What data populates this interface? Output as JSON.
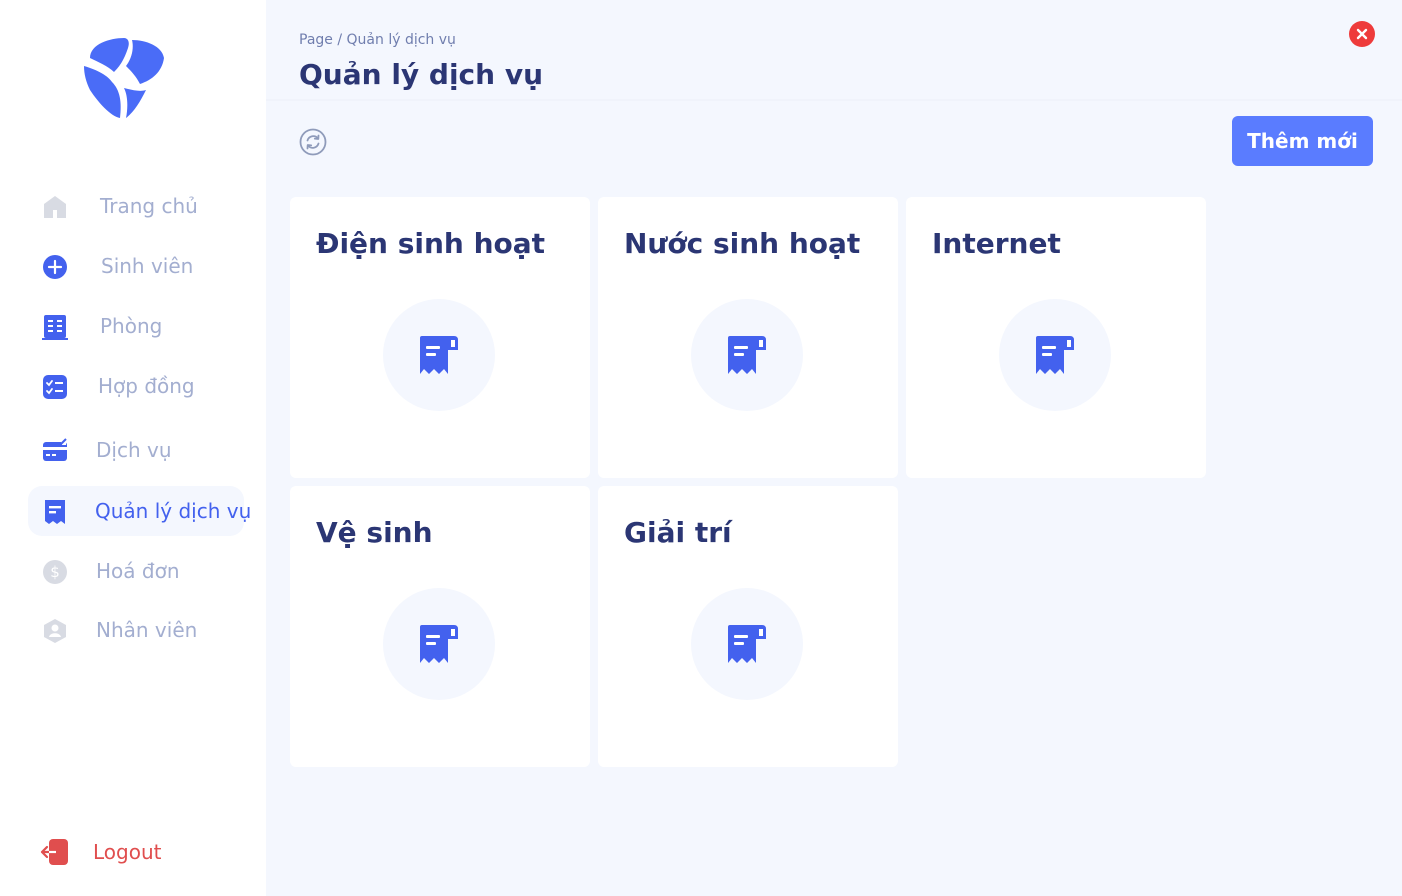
{
  "sidebar": {
    "items": [
      {
        "label": "Trang chủ",
        "icon": "home-icon"
      },
      {
        "label": "Sinh viên",
        "icon": "plus-circle-icon"
      },
      {
        "label": "Phòng",
        "icon": "building-icon"
      },
      {
        "label": "Hợp đồng",
        "icon": "checklist-icon"
      },
      {
        "label": "Dịch vụ",
        "icon": "card-edit-icon"
      },
      {
        "label": "Quản lý dịch vụ",
        "icon": "receipt-icon",
        "active": true
      },
      {
        "label": "Hoá đơn",
        "icon": "dollar-icon"
      },
      {
        "label": "Nhân viên",
        "icon": "user-icon"
      }
    ],
    "logout_label": "Logout"
  },
  "header": {
    "breadcrumb_root": "Page",
    "breadcrumb_sep": "/",
    "breadcrumb_current": "Quản lý dịch vụ",
    "title": "Quản lý dịch vụ"
  },
  "toolbar": {
    "add_label": "Thêm mới"
  },
  "services": [
    {
      "name": "Điện sinh hoạt"
    },
    {
      "name": "Nước sinh hoạt"
    },
    {
      "name": "Internet"
    },
    {
      "name": "Vệ sinh"
    },
    {
      "name": "Giải trí"
    }
  ],
  "colors": {
    "accent": "#4361ee",
    "primary_button": "#5a7cff",
    "title": "#2b3674",
    "muted": "#a3aed0",
    "danger": "#ee3b3b",
    "background": "#f4f7fe"
  }
}
